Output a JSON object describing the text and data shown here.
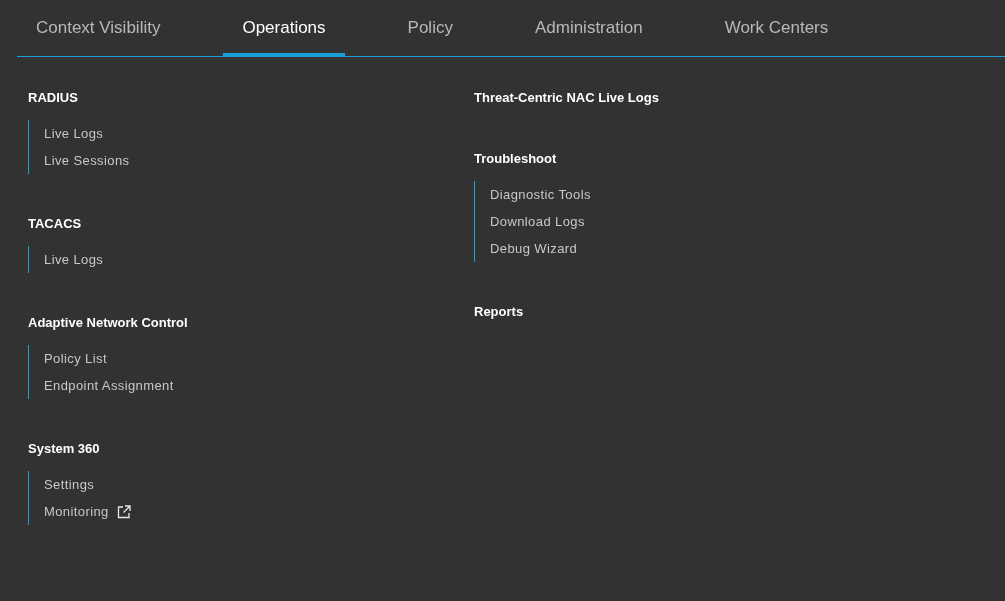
{
  "tabs": [
    {
      "label": "Context Visibility",
      "selected": false
    },
    {
      "label": "Operations",
      "selected": true
    },
    {
      "label": "Policy",
      "selected": false
    },
    {
      "label": "Administration",
      "selected": false
    },
    {
      "label": "Work Centers",
      "selected": false
    }
  ],
  "columns": [
    {
      "sections": [
        {
          "title": "RADIUS",
          "items": [
            {
              "label": "Live Logs"
            },
            {
              "label": "Live Sessions"
            }
          ]
        },
        {
          "title": "TACACS",
          "items": [
            {
              "label": "Live Logs"
            }
          ]
        },
        {
          "title": "Adaptive Network Control",
          "items": [
            {
              "label": "Policy List"
            },
            {
              "label": "Endpoint Assignment"
            }
          ]
        },
        {
          "title": "System 360",
          "items": [
            {
              "label": "Settings"
            },
            {
              "label": "Monitoring",
              "external": true
            }
          ]
        }
      ]
    },
    {
      "sections": [
        {
          "title": "Threat-Centric NAC Live Logs"
        },
        {
          "title": "Troubleshoot",
          "items": [
            {
              "label": "Diagnostic Tools"
            },
            {
              "label": "Download Logs"
            },
            {
              "label": "Debug Wizard"
            }
          ]
        },
        {
          "title": "Reports"
        }
      ]
    }
  ]
}
